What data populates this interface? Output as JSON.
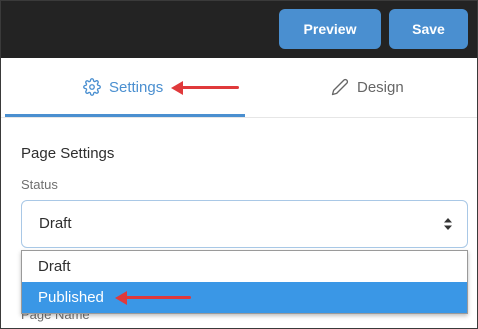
{
  "toolbar": {
    "preview_label": "Preview",
    "save_label": "Save"
  },
  "tabs": [
    {
      "label": "Settings",
      "icon": "gear-icon",
      "active": true
    },
    {
      "label": "Design",
      "icon": "pencil-icon",
      "active": false
    }
  ],
  "page_settings": {
    "title": "Page Settings",
    "status": {
      "label": "Status",
      "value": "Draft",
      "options": [
        {
          "label": "Draft",
          "highlighted": false
        },
        {
          "label": "Published",
          "highlighted": true
        }
      ]
    },
    "page_name_label": "Page Name"
  },
  "colors": {
    "accent": "#4a8fd0",
    "topbar": "#232323",
    "highlight": "#3a97e6",
    "annotation_arrow": "#e0393b"
  }
}
